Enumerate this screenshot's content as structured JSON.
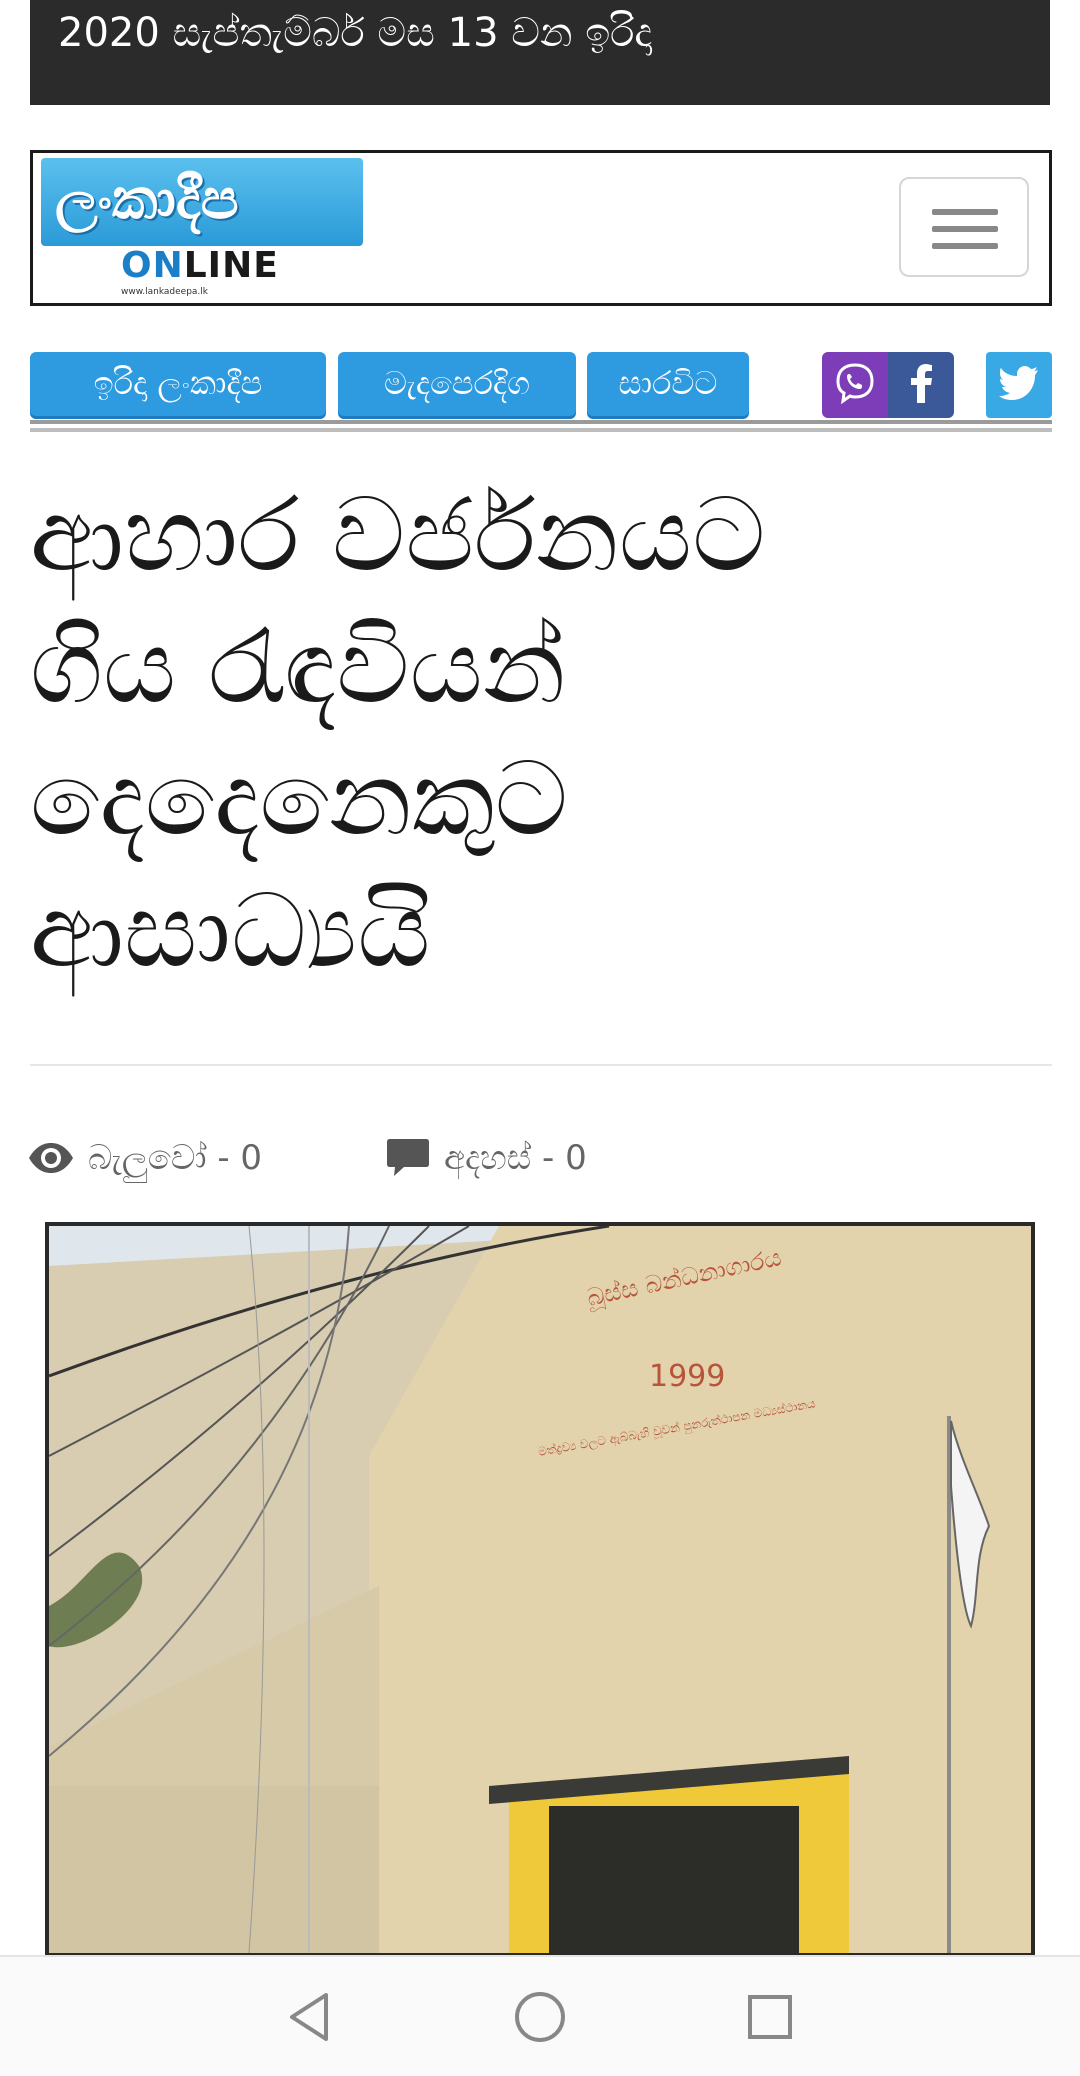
{
  "top_bar": {
    "date_text": "2020 සැප්තැම්බර් මස 13 වන ඉරිදා"
  },
  "header": {
    "logo": {
      "sinhala": "ලංකාදීප",
      "online_on": "ON",
      "online_line": "LINE",
      "url": "www.lankadeepa.lk"
    },
    "menu_icon": "hamburger-icon"
  },
  "nav": {
    "items": [
      {
        "label": "ඉරිදා ලංකාදීප"
      },
      {
        "label": "මැදපෙරදිග"
      },
      {
        "label": "සාරවිට"
      }
    ],
    "social": [
      "viber-icon",
      "facebook-icon",
      "twitter-icon"
    ],
    "colors": {
      "button": "#2e9ae0",
      "viber": "#7d3db8",
      "facebook": "#3b5998",
      "twitter": "#39a9e6"
    }
  },
  "article": {
    "headline_lines": [
      "ආහාර වර්ජනයට",
      "ගිය රැඳවියන්",
      "දෙදෙනෙකුට",
      "ආසාධ්‍යයි"
    ],
    "views_label": "බැලුවෝ - 0",
    "comments_label": "අදහස් - 0",
    "photo_text_line1": "බූස්ස බන්ධනාගාරය",
    "photo_text_line2": "1999",
    "photo_text_line3": "මත්ද්‍රව්‍ය වලට ඇබ්බැහි වූවන් පුනරුත්ථාපන මධ්‍යස්ථානය"
  },
  "system_nav": [
    "back-icon",
    "home-icon",
    "recents-icon"
  ]
}
